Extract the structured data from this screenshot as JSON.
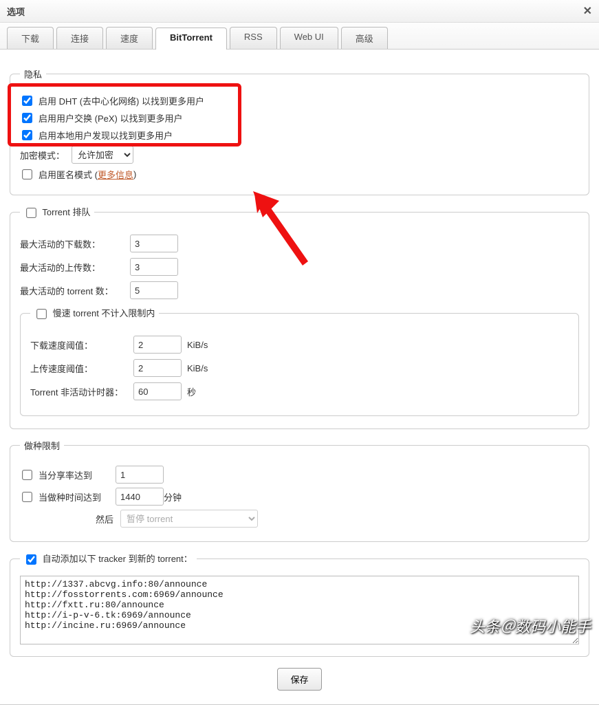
{
  "dialog": {
    "title": "选项",
    "close": "✕"
  },
  "tabs": {
    "items": [
      {
        "label": "下载",
        "active": false
      },
      {
        "label": "连接",
        "active": false
      },
      {
        "label": "速度",
        "active": false
      },
      {
        "label": "BitTorrent",
        "active": true
      },
      {
        "label": "RSS",
        "active": false
      },
      {
        "label": "Web UI",
        "active": false
      },
      {
        "label": "高级",
        "active": false
      }
    ]
  },
  "privacy": {
    "legend": "隐私",
    "dht": {
      "checked": true,
      "label": "启用 DHT (去中心化网络) 以找到更多用户"
    },
    "pex": {
      "checked": true,
      "label": "启用用户交换 (PeX) 以找到更多用户"
    },
    "lsd": {
      "checked": true,
      "label": "启用本地用户发现以找到更多用户"
    },
    "encryption_label": "加密模式：",
    "encryption_value": "允许加密",
    "anon": {
      "checked": false,
      "label_pre": "启用匿名模式 (",
      "link": "更多信息",
      "label_post": ")"
    }
  },
  "queue": {
    "enabled": false,
    "legend": "Torrent 排队",
    "max_dl_label": "最大活动的下载数：",
    "max_dl_value": "3",
    "max_ul_label": "最大活动的上传数：",
    "max_ul_value": "3",
    "max_active_label": "最大活动的 torrent 数：",
    "max_active_value": "5",
    "slow": {
      "enabled": false,
      "legend": "慢速 torrent 不计入限制内",
      "dl_label": "下载速度阈值：",
      "dl_value": "2",
      "ul_label": "上传速度阈值：",
      "ul_value": "2",
      "unit": "KiB/s",
      "timer_label": "Torrent 非活动计时器：",
      "timer_value": "60",
      "timer_unit": "秒"
    }
  },
  "seeding": {
    "legend": "做种限制",
    "ratio": {
      "checked": false,
      "label": "当分享率达到",
      "value": "1"
    },
    "time": {
      "checked": false,
      "label": "当做种时间达到",
      "value": "1440",
      "unit": "分钟"
    },
    "then_label": "然后",
    "then_value": "暂停 torrent"
  },
  "trackers": {
    "enabled": true,
    "legend": "自动添加以下 tracker 到新的 torrent：",
    "value": "http://1337.abcvg.info:80/announce\nhttp://fosstorrents.com:6969/announce\nhttp://fxtt.ru:80/announce\nhttp://i-p-v-6.tk:6969/announce\nhttp://incine.ru:6969/announce"
  },
  "save_label": "保存",
  "watermark": "头条＠数码小能手"
}
